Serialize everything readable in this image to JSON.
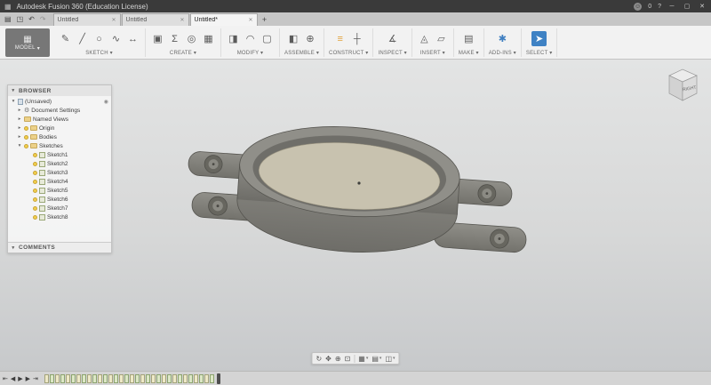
{
  "titlebar": {
    "title": "Autodesk Fusion 360 (Education License)",
    "badge": "0"
  },
  "icons": {
    "appgrid": "▦",
    "file": "▤",
    "save": "◳",
    "undo": "↶",
    "redo": "↷",
    "avatar": "☺",
    "help": "?",
    "minimize": "─",
    "maximize": "▢",
    "close": "✕",
    "dropdown": "▾",
    "open": "▾",
    "closed": "▸",
    "gear": "⚙",
    "radio": "◉",
    "modelgrid": "▦"
  },
  "tabstrip": {
    "tabs": [
      {
        "label": "Untitled",
        "active": false
      },
      {
        "label": "Untitled",
        "active": false
      },
      {
        "label": "Untitled*",
        "active": true
      }
    ],
    "new_tab": "+"
  },
  "toolbar": {
    "workspace": "MODEL",
    "groups": [
      {
        "label": "SKETCH",
        "icons": [
          {
            "name": "create-sketch-icon",
            "glyph": "✎"
          },
          {
            "name": "sketch-line-icon",
            "glyph": "╱"
          },
          {
            "name": "sketch-circle-icon",
            "glyph": "○"
          },
          {
            "name": "sketch-spline-icon",
            "glyph": "∿"
          },
          {
            "name": "sketch-dimension-icon",
            "glyph": "↔"
          }
        ]
      },
      {
        "label": "CREATE",
        "icons": [
          {
            "name": "extrude-icon",
            "glyph": "▣"
          },
          {
            "name": "create-form-icon",
            "glyph": "Σ"
          },
          {
            "name": "revolve-icon",
            "glyph": "◎"
          },
          {
            "name": "pattern-icon",
            "glyph": "▦"
          }
        ]
      },
      {
        "label": "MODIFY",
        "icons": [
          {
            "name": "press-pull-icon",
            "glyph": "◨"
          },
          {
            "name": "fillet-icon",
            "glyph": "◠"
          },
          {
            "name": "shell-icon",
            "glyph": "▢"
          }
        ]
      },
      {
        "label": "ASSEMBLE",
        "icons": [
          {
            "name": "new-component-icon",
            "glyph": "◧"
          },
          {
            "name": "joint-icon",
            "glyph": "⊕"
          }
        ]
      },
      {
        "label": "CONSTRUCT",
        "icons": [
          {
            "name": "offset-plane-icon",
            "glyph": "≡",
            "color": "#e2a23b"
          },
          {
            "name": "construction-axis-icon",
            "glyph": "┼"
          }
        ]
      },
      {
        "label": "INSPECT",
        "icons": [
          {
            "name": "measure-icon",
            "glyph": "∡"
          }
        ]
      },
      {
        "label": "INSERT",
        "icons": [
          {
            "name": "insert-mesh-icon",
            "glyph": "◬"
          },
          {
            "name": "decal-icon",
            "glyph": "▱"
          }
        ]
      },
      {
        "label": "MAKE",
        "icons": [
          {
            "name": "make-3d-print-icon",
            "glyph": "▤"
          }
        ]
      },
      {
        "label": "ADD-INS",
        "icons": [
          {
            "name": "scripts-addins-icon",
            "glyph": "✱",
            "color": "#3f7fc1"
          }
        ]
      },
      {
        "label": "SELECT",
        "icons": [
          {
            "name": "select-cursor-icon",
            "glyph": "➤",
            "bg": "#3f82c4",
            "color": "#ffffff"
          }
        ]
      }
    ]
  },
  "viewcube": {
    "face": "RIGHT"
  },
  "browser": {
    "header": "BROWSER",
    "comments_header": "COMMENTS",
    "rows": [
      {
        "level": 0,
        "expand": "open",
        "icon": "document",
        "label": "(Unsaved)",
        "trailing": "radio"
      },
      {
        "level": 1,
        "expand": "closed",
        "icon": "gear",
        "label": "Document Settings"
      },
      {
        "level": 1,
        "expand": "closed",
        "icon": "folder",
        "label": "Named Views"
      },
      {
        "level": 1,
        "expand": "closed",
        "icon": "folder",
        "label": "Origin",
        "bulb": true
      },
      {
        "level": 1,
        "expand": "closed",
        "icon": "folder",
        "label": "Bodies",
        "bulb": true
      },
      {
        "level": 1,
        "expand": "open",
        "icon": "folder",
        "label": "Sketches",
        "bulb": true
      },
      {
        "level": 2,
        "icon": "sketch",
        "label": "Sketch1",
        "bulb": true
      },
      {
        "level": 2,
        "icon": "sketch",
        "label": "Sketch2",
        "bulb": true
      },
      {
        "level": 2,
        "icon": "sketch",
        "label": "Sketch3",
        "bulb": true
      },
      {
        "level": 2,
        "icon": "sketch",
        "label": "Sketch4",
        "bulb": true
      },
      {
        "level": 2,
        "icon": "sketch",
        "label": "Sketch5",
        "bulb": true
      },
      {
        "level": 2,
        "icon": "sketch",
        "label": "Sketch6",
        "bulb": true
      },
      {
        "level": 2,
        "icon": "sketch",
        "label": "Sketch7",
        "bulb": true
      },
      {
        "level": 2,
        "icon": "sketch",
        "label": "Sketch8",
        "bulb": true
      }
    ]
  },
  "navbar": {
    "buttons": [
      {
        "name": "orbit-icon",
        "glyph": "↻"
      },
      {
        "name": "pan-icon",
        "glyph": "✥"
      },
      {
        "name": "zoom-icon",
        "glyph": "⊕"
      },
      {
        "name": "fit-icon",
        "glyph": "⊡"
      },
      {
        "sep": true
      },
      {
        "name": "display-settings-icon",
        "glyph": "▦",
        "dropdown": true
      },
      {
        "name": "grid-layout-icon",
        "glyph": "▤",
        "dropdown": true
      },
      {
        "name": "viewports-icon",
        "glyph": "◫",
        "dropdown": true
      }
    ]
  },
  "timeline": {
    "playback": [
      {
        "name": "go-to-start-icon",
        "glyph": "⇤"
      },
      {
        "name": "step-back-icon",
        "glyph": "◀"
      },
      {
        "name": "play-icon",
        "glyph": "▶"
      },
      {
        "name": "step-forward-icon",
        "glyph": "▶"
      },
      {
        "name": "go-to-end-icon",
        "glyph": "⇥"
      }
    ],
    "feature_type": "sketch",
    "feature_count": 32
  },
  "colors": {
    "accent_blue": "#3f82c4",
    "construct_orange": "#e2a23b",
    "bulb_yellow": "#f2cf4a",
    "model_face_tan": "#c8c2af",
    "model_body_gray": "#8b8a84"
  }
}
